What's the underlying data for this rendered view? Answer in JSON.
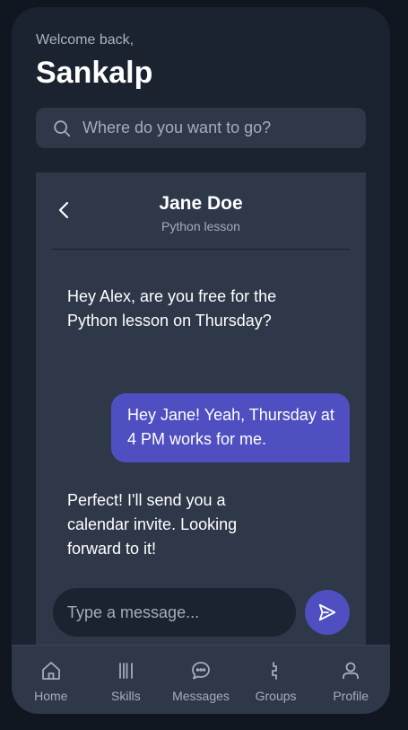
{
  "header": {
    "welcome": "Welcome back,",
    "username": "Sankalp"
  },
  "search": {
    "placeholder": "Where do you want to go?",
    "icon": "search-icon"
  },
  "chat": {
    "contact_name": "Jane Doe",
    "contact_subtitle": "Python lesson",
    "messages": [
      {
        "direction": "incoming",
        "text": "Hey Alex, are you free for the Python lesson on Thursday?"
      },
      {
        "direction": "outgoing",
        "text": "Hey Jane! Yeah, Thursday at 4 PM works for me."
      },
      {
        "direction": "incoming",
        "text": "Perfect! I'll send you a calendar invite. Looking forward to it!"
      }
    ],
    "composer_placeholder": "Type a message...",
    "accent_color": "#4f4fc1"
  },
  "nav": {
    "items": [
      {
        "label": "Home",
        "icon": "home-icon"
      },
      {
        "label": "Skills",
        "icon": "skills-icon"
      },
      {
        "label": "Messages",
        "icon": "messages-icon"
      },
      {
        "label": "Groups",
        "icon": "groups-icon"
      },
      {
        "label": "Profile",
        "icon": "profile-icon"
      }
    ]
  }
}
